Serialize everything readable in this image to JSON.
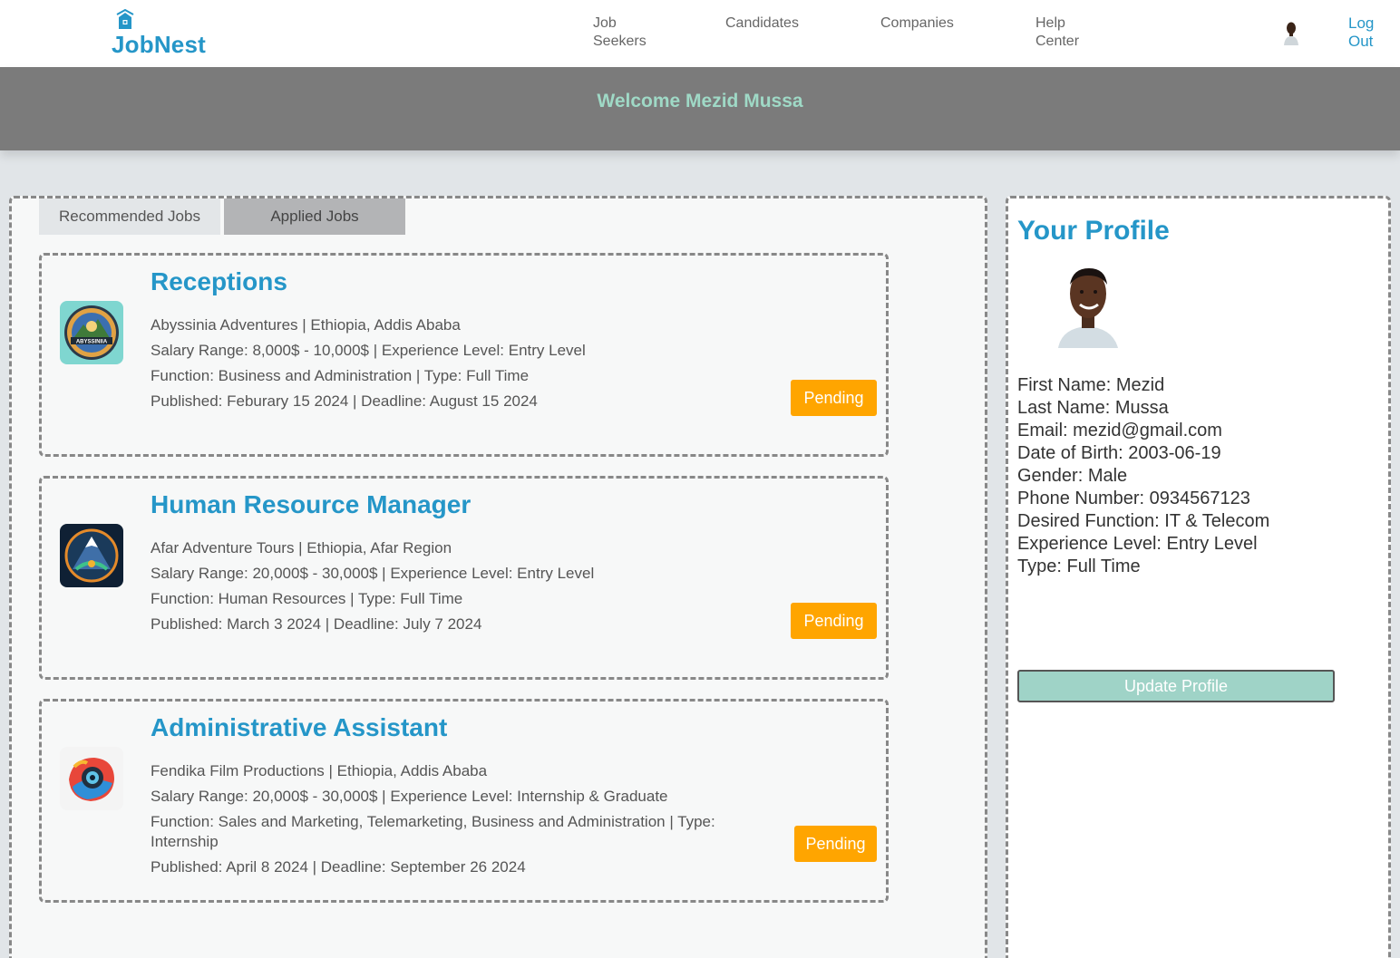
{
  "brand": {
    "name": "JobNest",
    "logo_icon": "house-icon",
    "accent": "#2596c8"
  },
  "nav": {
    "items": [
      {
        "label_line1": "Job",
        "label_line2": "Seekers"
      },
      {
        "label_line1": "Candidates",
        "label_line2": ""
      },
      {
        "label_line1": "Companies",
        "label_line2": ""
      },
      {
        "label_line1": "Help",
        "label_line2": "Center"
      }
    ],
    "logout_line1": "Log",
    "logout_line2": "Out"
  },
  "welcome": "Welcome Mezid Mussa",
  "tabs": {
    "recommended": "Recommended Jobs",
    "applied": "Applied Jobs",
    "active": "applied"
  },
  "jobs": [
    {
      "title": "Receptions",
      "company_line": "Abyssinia Adventures | Ethiopia, Addis Ababa",
      "salary_line": "Salary Range: 8,000$ - 10,000$ | Experience Level: Entry Level",
      "function_line": "Function: Business and Administration | Type: Full Time",
      "function_line2": "",
      "published_line": "Published: Feburary 15 2024 | Deadline: August 15 2024",
      "status": "Pending",
      "logo_text": "ABYSSINIIA"
    },
    {
      "title": "Human Resource Manager",
      "company_line": "Afar Adventure Tours | Ethiopia, Afar Region",
      "salary_line": "Salary Range: 20,000$ - 30,000$ | Experience Level: Entry Level",
      "function_line": "Function: Human Resources | Type: Full Time",
      "function_line2": "",
      "published_line": "Published: March 3 2024 | Deadline: July 7 2024",
      "status": "Pending"
    },
    {
      "title": "Administrative Assistant",
      "company_line": "Fendika Film Productions | Ethiopia, Addis Ababa",
      "salary_line": "Salary Range: 20,000$ - 30,000$ | Experience Level: Internship & Graduate",
      "function_line": "Function: Sales and Marketing, Telemarketing, Business and Administration | Type:",
      "function_line2": "Internship",
      "published_line": "Published: April 8 2024 | Deadline: September 26 2024",
      "status": "Pending"
    }
  ],
  "profile": {
    "title": "Your Profile",
    "fields": [
      "First Name: Mezid",
      "Last Name: Mussa",
      "Email: mezid@gmail.com",
      "Date of Birth: 2003-06-19",
      "Gender: Male",
      "Phone Number: 0934567123",
      "Desired Function: IT & Telecom",
      "Experience Level: Entry Level",
      "Type: Full Time"
    ],
    "update_label": "Update Profile"
  },
  "colors": {
    "pending": "#ffa500",
    "welcome_text": "#9fd9c6",
    "header_band": "#7b7b7b"
  }
}
